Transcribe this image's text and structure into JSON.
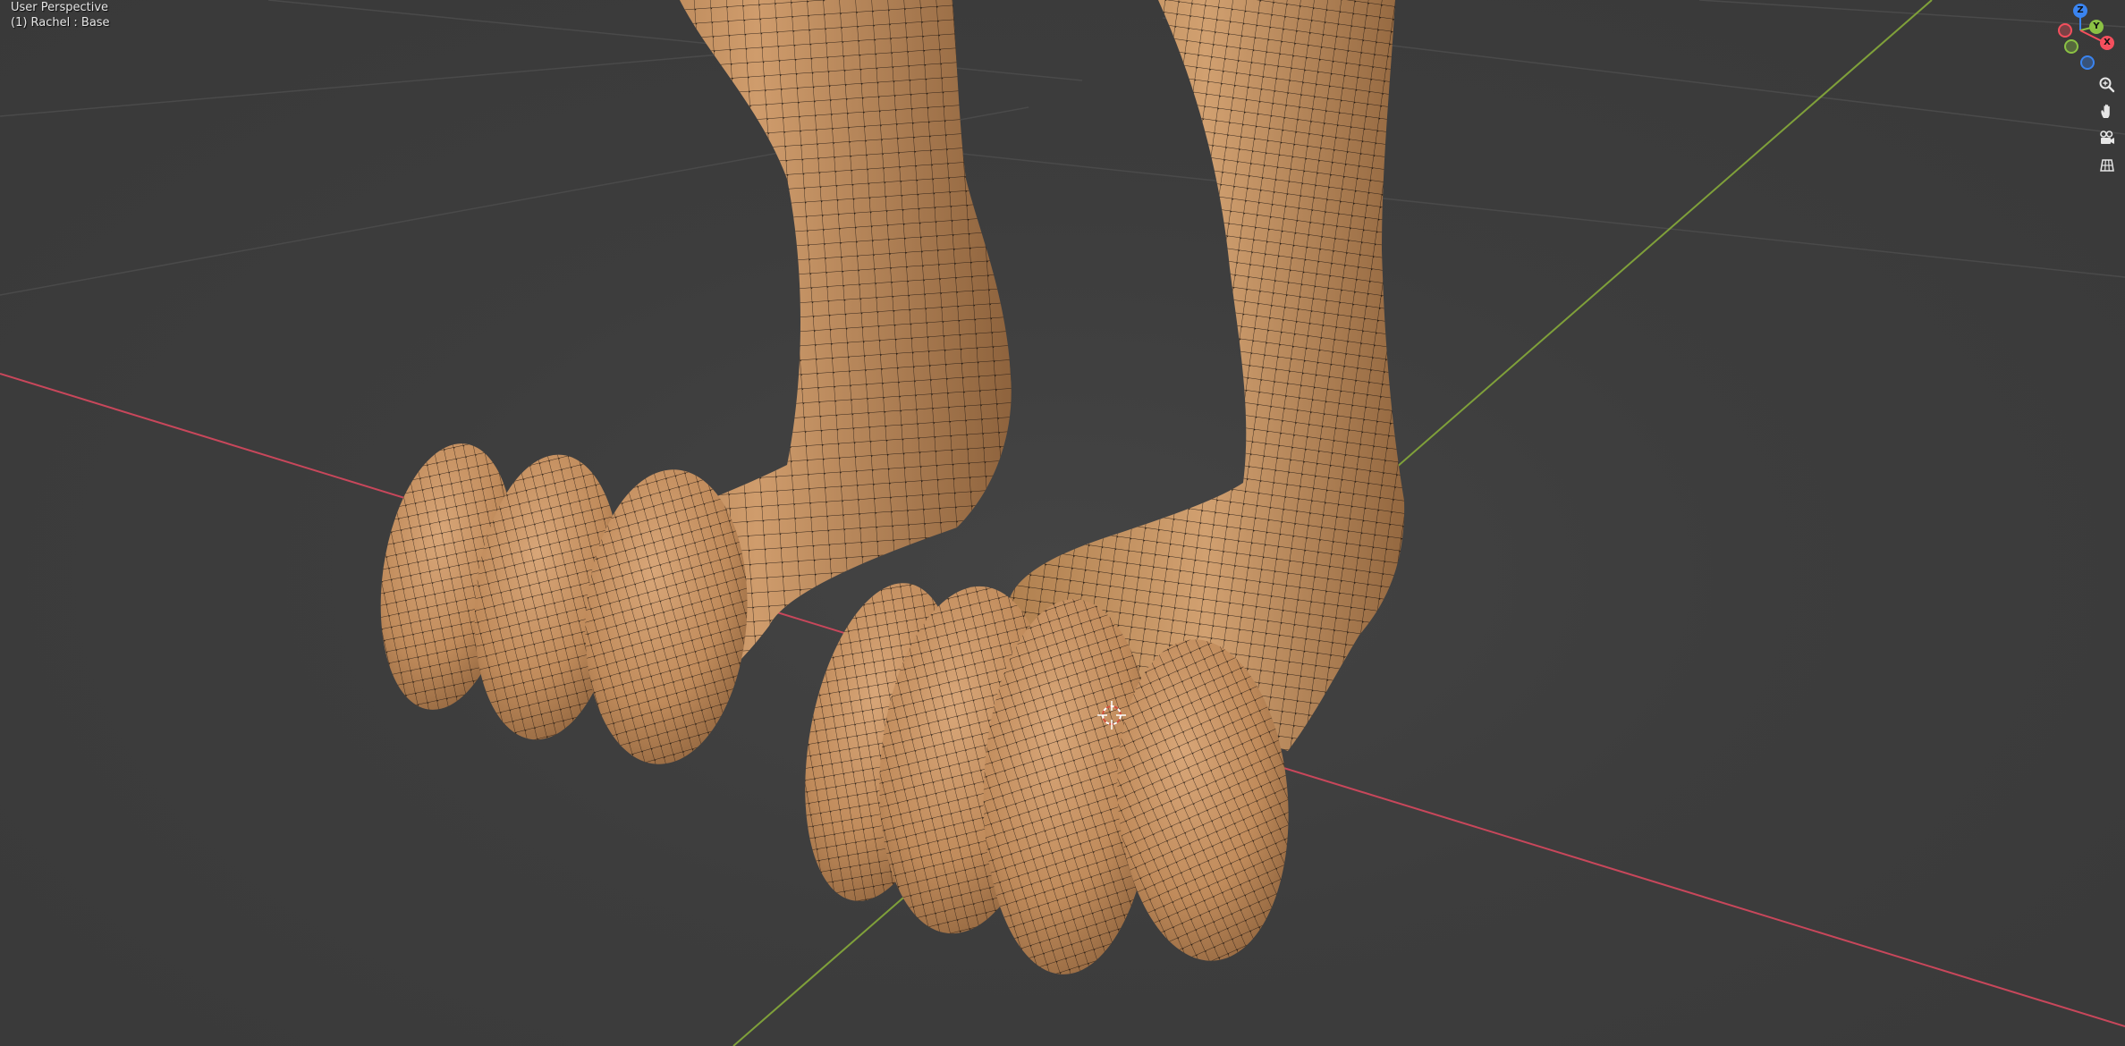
{
  "viewport": {
    "view_name": "User Perspective",
    "object_info": "(1) Rachel : Base"
  },
  "colors": {
    "background": "#3d3d3d",
    "grid_line": "#4a4a4a",
    "x_axis": "#c8475b",
    "y_axis": "#7fa03a",
    "mesh_skin": "#c69363",
    "mesh_shadow": "#8a5e38",
    "wire": "#1e1510",
    "vertex": "#0d0a08",
    "cursor_outer": "#ffffff",
    "cursor_inner": "#d2503c",
    "gizmo_x": "#f54f5d",
    "gizmo_y": "#8bc144",
    "gizmo_z": "#3a84f0",
    "text": "#e6e6e6"
  },
  "gizmo": {
    "x_label": "X",
    "y_label": "Y",
    "z_label": "Z"
  },
  "nav_buttons": [
    {
      "icon": "zoom-icon"
    },
    {
      "icon": "pan-hand-icon"
    },
    {
      "icon": "camera-view-icon"
    },
    {
      "icon": "ortho-grid-icon"
    }
  ]
}
